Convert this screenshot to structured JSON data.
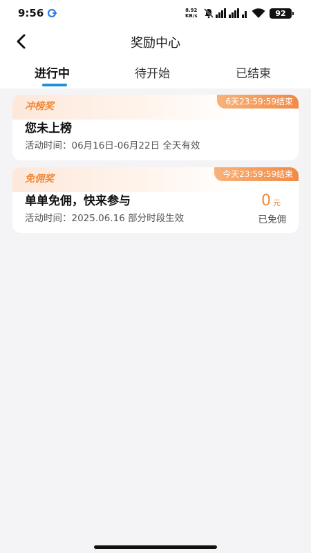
{
  "status_bar": {
    "time": "9:56",
    "net_speed_value": "8.92",
    "net_speed_unit": "KB/s",
    "battery": "92"
  },
  "header": {
    "title": "奖励中心"
  },
  "tabs": [
    {
      "label": "进行中",
      "active": true
    },
    {
      "label": "待开始",
      "active": false
    },
    {
      "label": "已结束",
      "active": false
    }
  ],
  "cards": [
    {
      "tag": "冲榜奖",
      "countdown": "6天23:59:59结束",
      "title": "您未上榜",
      "period": "活动时间：06月16日-06月22日 全天有效"
    },
    {
      "tag": "免佣奖",
      "countdown": "今天23:59:59结束",
      "title": "单单免佣，快来参与",
      "period": "活动时间：2025.06.16 部分时段生效",
      "reward_amount": "0",
      "reward_unit": "元",
      "reward_label": "已免佣"
    }
  ],
  "colors": {
    "accent": "#1e8fd9",
    "reward_orange": "#f08a3a",
    "background": "#f4f4f6"
  }
}
